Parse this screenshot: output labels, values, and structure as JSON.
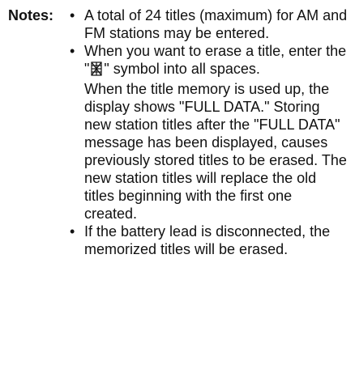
{
  "notes": {
    "label": "Notes:",
    "bullet_char": "•",
    "items": [
      {
        "text": "A total of 24 titles (maximum) for AM and FM stations may be entered."
      },
      {
        "text_before_symbol": "When you want to erase a title, enter the \"",
        "symbol_icon": "segment-all-on-icon",
        "text_after_symbol": "\" symbol into all spaces.",
        "paragraph2": "When the title memory is used up, the display shows \"FULL DATA.\" Storing new station titles after the \"FULL DATA\" message has been displayed, causes previously stored titles to be erased. The new station titles will replace the old titles beginning with the first one created."
      },
      {
        "text": "If the battery lead is disconnected, the memorized titles will be erased."
      }
    ]
  }
}
